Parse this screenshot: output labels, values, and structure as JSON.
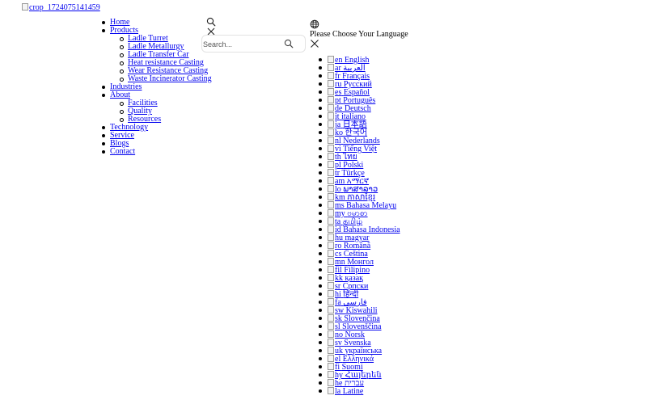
{
  "header": {
    "logo_alt": "crop_1724075141459"
  },
  "nav": {
    "home": "Home",
    "products": "Products",
    "products_items": [
      "Ladle Turret",
      "Ladle Metallurgy",
      "Ladle Transfer Car",
      "Heat resistance Casting",
      "Wear Resistance Casting",
      "Waste Incinerator Casting"
    ],
    "industries": "Industries",
    "about": "About",
    "about_items": [
      "Facilities",
      "Quality",
      "Resources"
    ],
    "technology": "Technology",
    "service": "Service",
    "blogs": "Blogs",
    "contact": "Contact"
  },
  "search": {
    "placeholder": "Search...",
    "icons": [
      "search-icon",
      "close-icon",
      "search-icon"
    ]
  },
  "language": {
    "title": "Please Choose Your Language",
    "icons": [
      "globe-icon",
      "close-icon"
    ],
    "items": [
      {
        "code": "en",
        "name": "English"
      },
      {
        "code": "ar",
        "name": "العربية"
      },
      {
        "code": "fr",
        "name": "Français"
      },
      {
        "code": "ru",
        "name": "Русский"
      },
      {
        "code": "es",
        "name": "Español"
      },
      {
        "code": "pt",
        "name": "Português"
      },
      {
        "code": "de",
        "name": "Deutsch"
      },
      {
        "code": "it",
        "name": "italiano"
      },
      {
        "code": "ja",
        "name": "日本語"
      },
      {
        "code": "ko",
        "name": "한국어"
      },
      {
        "code": "nl",
        "name": "Nederlands"
      },
      {
        "code": "vi",
        "name": "Tiếng Việt"
      },
      {
        "code": "th",
        "name": "ไทย"
      },
      {
        "code": "pl",
        "name": "Polski"
      },
      {
        "code": "tr",
        "name": "Türkçe"
      },
      {
        "code": "am",
        "name": "አማርኛ"
      },
      {
        "code": "lo",
        "name": "ພາສາລາວ"
      },
      {
        "code": "km",
        "name": "ភាសាខ្មែរ"
      },
      {
        "code": "ms",
        "name": "Bahasa Melayu"
      },
      {
        "code": "my",
        "name": "ဗမာစာ"
      },
      {
        "code": "ta",
        "name": "தமிழ்"
      },
      {
        "code": "id",
        "name": "Bahasa Indonesia"
      },
      {
        "code": "hu",
        "name": "magyar"
      },
      {
        "code": "ro",
        "name": "Română"
      },
      {
        "code": "cs",
        "name": "Čeština"
      },
      {
        "code": "mn",
        "name": "Монгол"
      },
      {
        "code": "fil",
        "name": "Filipino"
      },
      {
        "code": "kk",
        "name": "қазақ"
      },
      {
        "code": "sr",
        "name": "Српски"
      },
      {
        "code": "hi",
        "name": "हिन्दी"
      },
      {
        "code": "fa",
        "name": "فارسی"
      },
      {
        "code": "sw",
        "name": "Kiswahili"
      },
      {
        "code": "sk",
        "name": "Slovenčina"
      },
      {
        "code": "sl",
        "name": "Slovenščina"
      },
      {
        "code": "no",
        "name": "Norsk"
      },
      {
        "code": "sv",
        "name": "Svenska"
      },
      {
        "code": "uk",
        "name": "українська"
      },
      {
        "code": "el",
        "name": "Ελληνικά"
      },
      {
        "code": "fi",
        "name": "Suomi"
      },
      {
        "code": "hy",
        "name": "Հայերեն"
      },
      {
        "code": "he",
        "name": "עברית"
      },
      {
        "code": "la",
        "name": "Latine"
      }
    ]
  },
  "colors": {
    "link": "#0000ee",
    "text": "#000000",
    "search_border": "#e3e3e3"
  }
}
